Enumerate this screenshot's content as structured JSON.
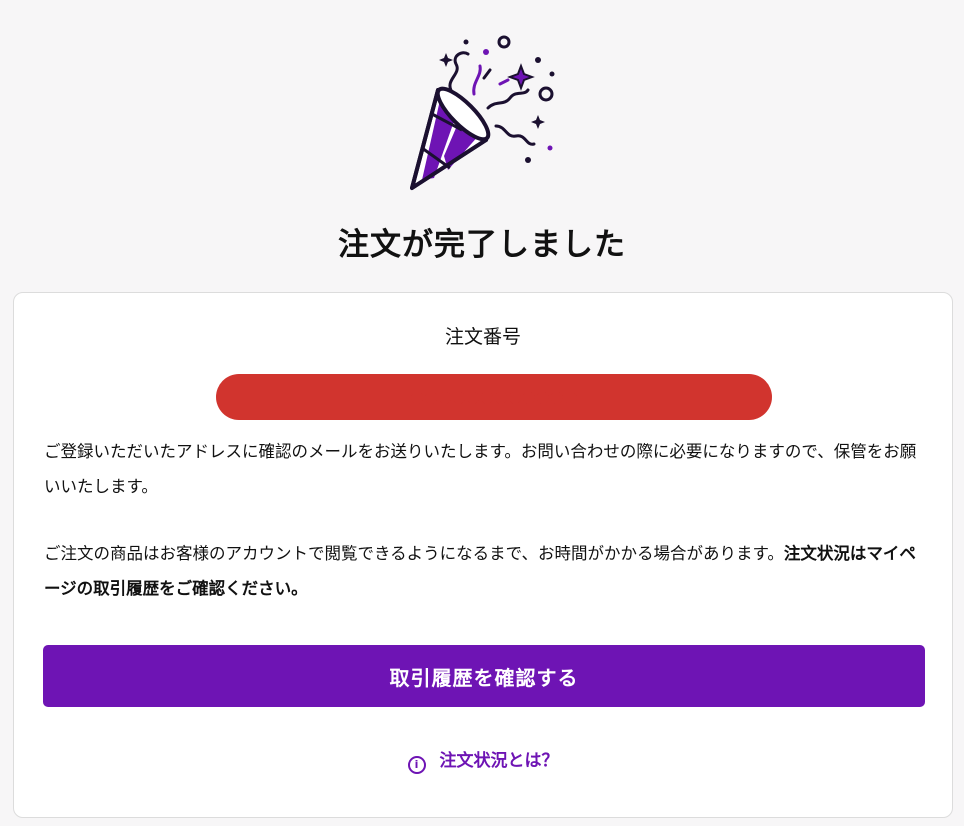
{
  "header": {
    "icon": "party-popper-icon",
    "title": "注文が完了しました"
  },
  "order": {
    "label": "注文番号",
    "number": "●●●●●●●●●●●●",
    "number_redacted": true,
    "redaction_color": "#d1342e"
  },
  "messages": {
    "line1": "ご登録いただいたアドレスに確認のメールをお送りいたします。お問い合わせの際に必要になりますので、保管をお願いいたします。",
    "line2_normal": "ご注文の商品はお客様のアカウントで閲覧できるようになるまで、お時間がかかる場合があります。",
    "line2_bold": "注文状況はマイページの取引履歴をご確認ください。"
  },
  "actions": {
    "primary_label": "取引履歴を確認する",
    "help_icon": "info-icon",
    "help_label": "注文状況とは？"
  },
  "colors": {
    "accent": "#6e14b4",
    "background": "#f7f6f7",
    "card": "#ffffff"
  }
}
